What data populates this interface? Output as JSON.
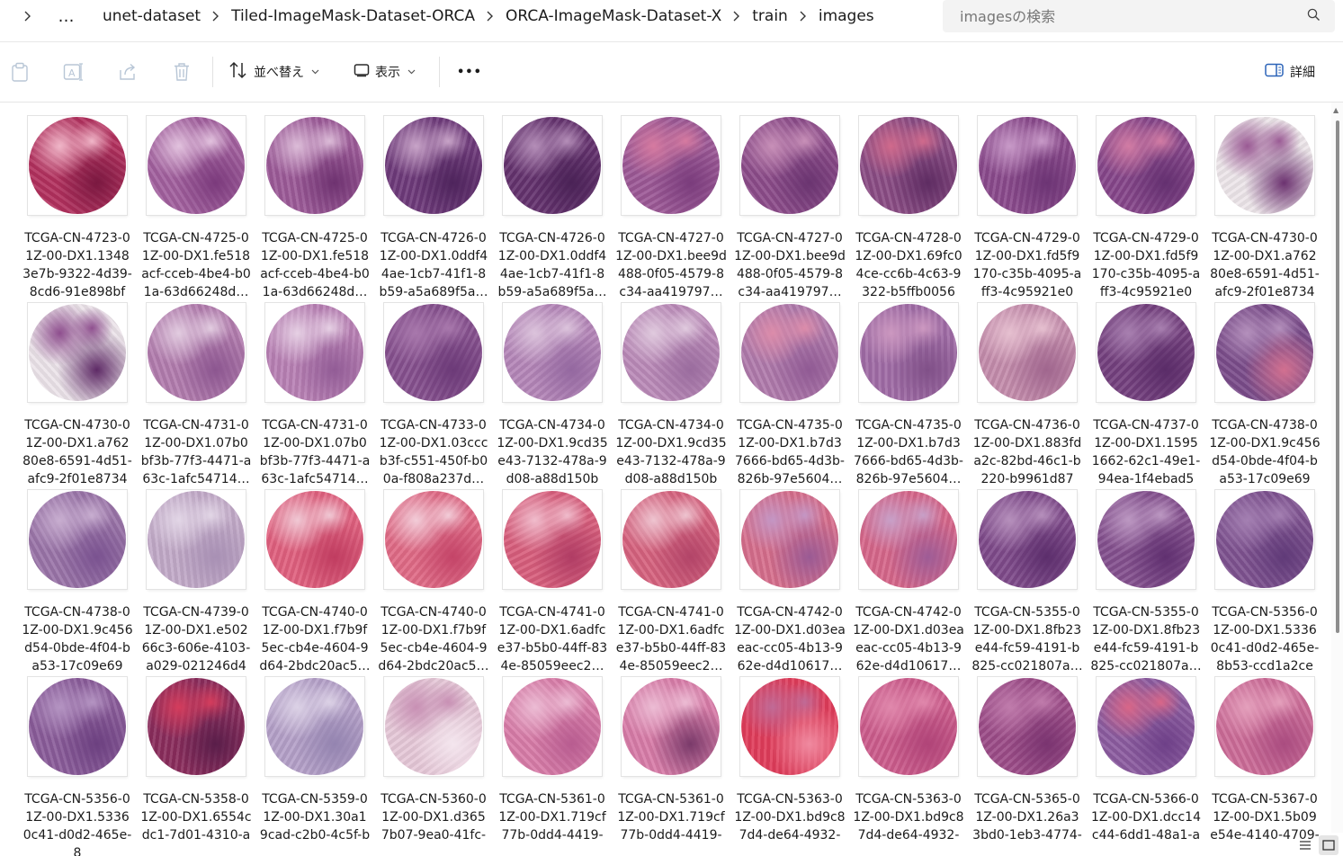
{
  "breadcrumb": {
    "overflow": "…",
    "items": [
      "unet-dataset",
      "Tiled-ImageMask-Dataset-ORCA",
      "ORCA-ImageMask-Dataset-X",
      "train",
      "images"
    ]
  },
  "search": {
    "placeholder": "imagesの検索"
  },
  "toolbar": {
    "sort_label": "並べ替え",
    "view_label": "表示",
    "more_label": "•••",
    "details_label": "詳細"
  },
  "files": [
    {
      "name": "TCGA-CN-4723-01Z-00-DX1.13483e7b-9322-4d39-8cd6-91e898bf2…",
      "colors": [
        "#b2305e",
        "#f0b6c8",
        "#7a1840"
      ]
    },
    {
      "name": "TCGA-CN-4725-01Z-00-DX1.fe518acf-cceb-4be4-b01a-63d66248d…",
      "colors": [
        "#a2609e",
        "#e2c2de",
        "#7b3a7c"
      ]
    },
    {
      "name": "TCGA-CN-4725-01Z-00-DX1.fe518acf-cceb-4be4-b01a-63d66248d…",
      "colors": [
        "#9c5a98",
        "#dcbcd8",
        "#6e3270"
      ]
    },
    {
      "name": "TCGA-CN-4726-01Z-00-DX1.0ddf44ae-1cb7-41f1-8b59-a5a689f5a…",
      "colors": [
        "#6e3a7a",
        "#c8a4c8",
        "#4e245c"
      ]
    },
    {
      "name": "TCGA-CN-4726-01Z-00-DX1.0ddf44ae-1cb7-41f1-8b59-a5a689f5a…",
      "colors": [
        "#64326e",
        "#b48eb8",
        "#4a2256"
      ]
    },
    {
      "name": "TCGA-CN-4727-01Z-00-DX1.bee9d488-0f05-4579-8c34-aa419797…",
      "colors": [
        "#9c5896",
        "#d67aa0",
        "#7a3c7c"
      ]
    },
    {
      "name": "TCGA-CN-4727-01Z-00-DX1.bee9d488-0f05-4579-8c34-aa419797…",
      "colors": [
        "#8c4c8a",
        "#c890b8",
        "#6a3470"
      ]
    },
    {
      "name": "TCGA-CN-4728-01Z-00-DX1.69fc04ce-cc6b-4c63-9322-b5ffb00568…",
      "colors": [
        "#8a4c84",
        "#d06a8c",
        "#5e2c62"
      ]
    },
    {
      "name": "TCGA-CN-4729-01Z-00-DX1.fd5f9170-c35b-4095-aff3-4c95921e0e…",
      "colors": [
        "#8a4a8c",
        "#c89ac8",
        "#6c3474"
      ]
    },
    {
      "name": "TCGA-CN-4729-01Z-00-DX1.fd5f9170-c35b-4095-aff3-4c95921e0e…",
      "colors": [
        "#86468a",
        "#d27ca4",
        "#643070"
      ]
    },
    {
      "name": "TCGA-CN-4730-01Z-00-DX1.a76280e8-6591-4d51-afc9-2f01e87346…",
      "colors": [
        "#ede6ea",
        "#9a5a94",
        "#6c3270"
      ]
    },
    {
      "name": "TCGA-CN-4730-01Z-00-DX1.a76280e8-6591-4d51-afc9-2f01e87346…",
      "colors": [
        "#ece4ea",
        "#8e4e8e",
        "#5e2a66"
      ]
    },
    {
      "name": "TCGA-CN-4731-01Z-00-DX1.07b0bf3b-77f3-4471-a63c-1afc54714…",
      "colors": [
        "#b27cae",
        "#e2cce0",
        "#8c5690"
      ]
    },
    {
      "name": "TCGA-CN-4731-01Z-00-DX1.07b0bf3b-77f3-4471-a63c-1afc54714…",
      "colors": [
        "#b880b4",
        "#e6d0e4",
        "#925c96"
      ]
    },
    {
      "name": "TCGA-CN-4733-01Z-00-DX1.03cccb3f-c551-450f-b00a-f808a237d…",
      "colors": [
        "#86508e",
        "#a878ac",
        "#6c3a78"
      ]
    },
    {
      "name": "TCGA-CN-4734-01Z-00-DX1.9cd35e43-7132-478a-9d08-a88d150b7…",
      "colors": [
        "#b486b8",
        "#dcc4dc",
        "#9468a0"
      ]
    },
    {
      "name": "TCGA-CN-4734-01Z-00-DX1.9cd35e43-7132-478a-9d08-a88d150b7…",
      "colors": [
        "#ba8ab8",
        "#e0cade",
        "#9a6c9e"
      ]
    },
    {
      "name": "TCGA-CN-4735-01Z-00-DX1.b7d37666-bd65-4d3b-826b-97e5604…",
      "colors": [
        "#b07aac",
        "#dc8caa",
        "#905a94"
      ]
    },
    {
      "name": "TCGA-CN-4735-01Z-00-DX1.b7d37666-bd65-4d3b-826b-97e5604…",
      "colors": [
        "#a06ca6",
        "#cc98c0",
        "#805088"
      ]
    },
    {
      "name": "TCGA-CN-4736-01Z-00-DX1.883fda2c-82bd-46c1-b220-b9961d870…",
      "colors": [
        "#c48cac",
        "#e6c0d0",
        "#a0668e"
      ]
    },
    {
      "name": "TCGA-CN-4737-01Z-00-DX1.15951662-62c1-49e1-94ea-1f4ebad55…",
      "colors": [
        "#74407e",
        "#a880b0",
        "#5a2c68"
      ]
    },
    {
      "name": "TCGA-CN-4738-01Z-00-DX1.9c456d54-0bde-4f04-ba53-17c09e692…",
      "colors": [
        "#7a4c8a",
        "#b490bc",
        "#d27090"
      ]
    },
    {
      "name": "TCGA-CN-4738-01Z-00-DX1.9c456d54-0bde-4f04-ba53-17c09e692…",
      "colors": [
        "#9a74a8",
        "#c8aed0",
        "#7a5290"
      ]
    },
    {
      "name": "TCGA-CN-4739-01Z-00-DX1.e50266c3-606e-4103-a029-021246d4d…",
      "colors": [
        "#c2aac8",
        "#e2d6e6",
        "#a890b4"
      ]
    },
    {
      "name": "TCGA-CN-4740-01Z-00-DX1.f7b9f5ec-cb4e-4604-9d64-2bdc20ac5…",
      "colors": [
        "#e0607e",
        "#f0c8d4",
        "#c03c60"
      ]
    },
    {
      "name": "TCGA-CN-4740-01Z-00-DX1.f7b9f5ec-cb4e-4604-9d64-2bdc20ac5…",
      "colors": [
        "#e06a86",
        "#f2ccd8",
        "#c44468"
      ]
    },
    {
      "name": "TCGA-CN-4741-01Z-00-DX1.6adfce37-b5b0-44ff-834e-85059eec2…",
      "colors": [
        "#d85e7c",
        "#f0bccc",
        "#b03c64"
      ]
    },
    {
      "name": "TCGA-CN-4741-01Z-00-DX1.6adfce37-b5b0-44ff-834e-85059eec2…",
      "colors": [
        "#d6627e",
        "#eec4d0",
        "#b24468"
      ]
    },
    {
      "name": "TCGA-CN-4742-01Z-00-DX1.d03eaeac-cc05-4b13-962e-d4d10617…",
      "colors": [
        "#d66e8c",
        "#c496c4",
        "#9a5a94"
      ]
    },
    {
      "name": "TCGA-CN-4742-01Z-00-DX1.d03eaeac-cc05-4b13-962e-d4d10617…",
      "colors": [
        "#d6668a",
        "#c8a0c8",
        "#9e5c96"
      ]
    },
    {
      "name": "TCGA-CN-5355-01Z-00-DX1.8fb23e44-fc59-4191-b825-cc021807a…",
      "colors": [
        "#7e4a8a",
        "#b690bc",
        "#5c2e6c"
      ]
    },
    {
      "name": "TCGA-CN-5355-01Z-00-DX1.8fb23e44-fc59-4191-b825-cc021807a…",
      "colors": [
        "#84508e",
        "#bc98c2",
        "#603070"
      ]
    },
    {
      "name": "TCGA-CN-5356-01Z-00-DX1.53360c41-d0d2-465e-8b53-ccd1a2ce2…",
      "colors": [
        "#7e5290",
        "#a480b2",
        "#603a78"
      ]
    },
    {
      "name": "TCGA-CN-5356-01Z-00-DX1.53360c41-d0d2-465e-8",
      "colors": [
        "#8a5c9a",
        "#b494c2",
        "#6c4080"
      ]
    },
    {
      "name": "TCGA-CN-5358-01Z-00-DX1.6554cdc1-7d01-4310-a",
      "colors": [
        "#8a2c5c",
        "#d43c5c",
        "#5a1e4a"
      ]
    },
    {
      "name": "TCGA-CN-5359-01Z-00-DX1.30a19cad-c2b0-4c5f-b",
      "colors": [
        "#b4a0c8",
        "#dcd2e6",
        "#9484b0"
      ]
    },
    {
      "name": "TCGA-CN-5360-01Z-00-DX1.d3657b07-9ea0-41fc-",
      "colors": [
        "#e6c8d8",
        "#c890b4",
        "#f4e6ee"
      ]
    },
    {
      "name": "TCGA-CN-5361-01Z-00-DX1.719cf77b-0dd4-4419-",
      "colors": [
        "#d87ca8",
        "#ecbcd4",
        "#b85c90"
      ]
    },
    {
      "name": "TCGA-CN-5361-01Z-00-DX1.719cf77b-0dd4-4419-",
      "colors": [
        "#d87ca8",
        "#ecbcd4",
        "#7a3a6a"
      ]
    },
    {
      "name": "TCGA-CN-5363-01Z-00-DX1.bd9c87d4-de64-4932-",
      "colors": [
        "#e03c5a",
        "#c06a96",
        "#f08aa0"
      ]
    },
    {
      "name": "TCGA-CN-5363-01Z-00-DX1.bd9c87d4-de64-4932-",
      "colors": [
        "#cc5c8c",
        "#e088ac",
        "#b04478"
      ]
    },
    {
      "name": "TCGA-CN-5365-01Z-00-DX1.26a33bd0-1eb3-4774-",
      "colors": [
        "#9c4c88",
        "#c07cac",
        "#7a3470"
      ]
    },
    {
      "name": "TCGA-CN-5366-01Z-00-DX1.dcc14c44-6dd1-48a1-a",
      "colors": [
        "#8c5ca0",
        "#d86688",
        "#6e4088"
      ]
    },
    {
      "name": "TCGA-CN-5367-01Z-00-DX1.5b09e54e-4140-4709-",
      "colors": [
        "#cc6c98",
        "#e4a0bc",
        "#aa4c80"
      ]
    }
  ]
}
